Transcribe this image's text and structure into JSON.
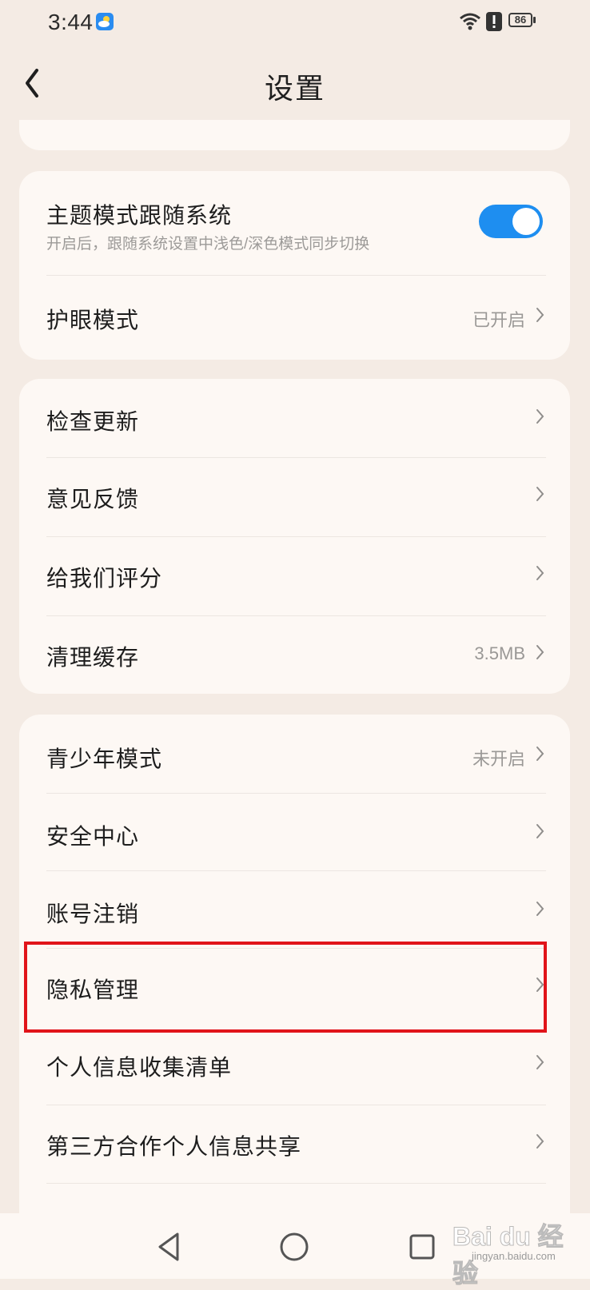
{
  "status_bar": {
    "time": "3:44",
    "battery": "86"
  },
  "header": {
    "title": "设置"
  },
  "section1": {
    "theme_follow": {
      "label": "主题模式跟随系统",
      "subtitle": "开启后，跟随系统设置中浅色/深色模式同步切换",
      "toggle_on": true
    },
    "eye_care": {
      "label": "护眼模式",
      "value": "已开启"
    }
  },
  "section2": {
    "items": [
      {
        "label": "检查更新",
        "value": ""
      },
      {
        "label": "意见反馈",
        "value": ""
      },
      {
        "label": "给我们评分",
        "value": ""
      },
      {
        "label": "清理缓存",
        "value": "3.5MB"
      }
    ]
  },
  "section3": {
    "items": [
      {
        "label": "青少年模式",
        "value": "未开启"
      },
      {
        "label": "安全中心",
        "value": ""
      },
      {
        "label": "账号注销",
        "value": ""
      },
      {
        "label": "隐私管理",
        "value": ""
      },
      {
        "label": "个人信息收集清单",
        "value": ""
      },
      {
        "label": "第三方合作个人信息共享",
        "value": ""
      }
    ]
  },
  "watermark": {
    "main": "Bai du 经验",
    "sub": "jingyan.baidu.com"
  },
  "colors": {
    "toggle_on": "#1e8ef0",
    "highlight": "#e1141a",
    "background": "#f4ebe4",
    "card": "#fdf8f4"
  }
}
